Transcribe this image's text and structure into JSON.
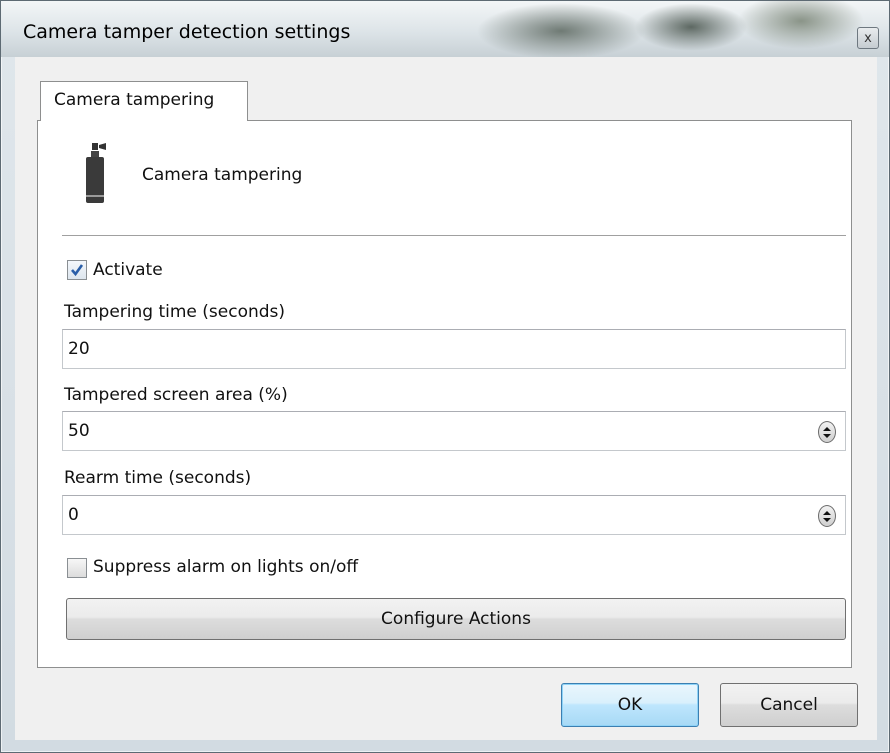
{
  "window": {
    "title": "Camera tamper detection settings",
    "close_glyph": "x"
  },
  "tab": {
    "label": "Camera tampering"
  },
  "header": {
    "icon": "spray-can-icon",
    "label": "Camera tampering"
  },
  "activate": {
    "label": "Activate",
    "checked": true
  },
  "tampering_time": {
    "label": "Tampering time (seconds)",
    "value": "20"
  },
  "screen_area": {
    "label": "Tampered screen area (%)",
    "value": "50"
  },
  "rearm_time": {
    "label": "Rearm time (seconds)",
    "value": "0"
  },
  "suppress": {
    "label": "Suppress alarm on lights on/off",
    "checked": false
  },
  "buttons": {
    "configure": "Configure Actions",
    "ok": "OK",
    "cancel": "Cancel"
  },
  "colors": {
    "accent": "#3c7fb1",
    "check": "#2a5ea8"
  }
}
